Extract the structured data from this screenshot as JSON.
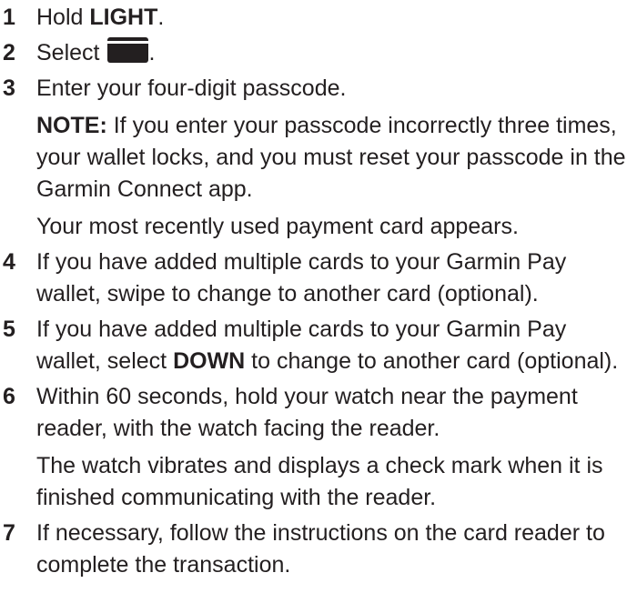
{
  "steps": [
    {
      "num": "1",
      "pre": "Hold ",
      "bold": "LIGHT",
      "post": "."
    },
    {
      "num": "2",
      "pre": "Select ",
      "icon": "wallet-icon",
      "post": "."
    },
    {
      "num": "3",
      "text": "Enter your four-digit passcode.",
      "note_label": "NOTE:",
      "note_text": " If you enter your passcode incorrectly three times, your wallet locks, and you must reset your passcode in the Garmin Connect app.",
      "result": "Your most recently used payment card appears."
    },
    {
      "num": "4",
      "text": "If you have added multiple cards to your Garmin Pay wallet, swipe to change to another card (optional)."
    },
    {
      "num": "5",
      "pre": "If you have added multiple cards to your Garmin Pay wallet, select ",
      "bold": "DOWN",
      "post": " to change to another card (optional)."
    },
    {
      "num": "6",
      "text": "Within 60 seconds, hold your watch near the payment reader, with the watch facing the reader.",
      "result": "The watch vibrates and displays a check mark when it is finished communicating with the reader."
    },
    {
      "num": "7",
      "text": "If necessary, follow the instructions on the card reader to complete the transaction."
    }
  ]
}
